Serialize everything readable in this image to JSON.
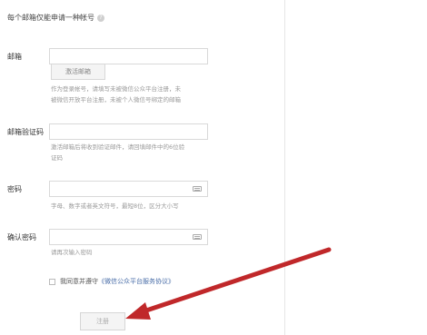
{
  "form": {
    "title": "每个邮箱仅能申请一种帐号",
    "help_icon_glyph": "?",
    "email_label": "邮箱",
    "activate_button": "激活邮箱",
    "email_hint_1": "作为登录帐号，请填写未被微信公众平台注册，未",
    "email_hint_2": "被微信开放平台注册，未被个人微信号绑定的邮箱",
    "code_label": "邮箱验证码",
    "code_hint_1": "激活邮箱后将收到验证邮件，请回填邮件中的6位验",
    "code_hint_2": "证码",
    "password_label": "密码",
    "password_hint": "字母、数字或者英文符号，最短8位，区分大小写",
    "confirm_label": "确认密码",
    "confirm_hint": "请再次输入密码",
    "agree_prefix": "我同意并遵守",
    "agree_link": "《微信公众平台服务协议》",
    "register_button": "注册"
  },
  "annotation": {
    "arrow_color": "#c0282a"
  }
}
